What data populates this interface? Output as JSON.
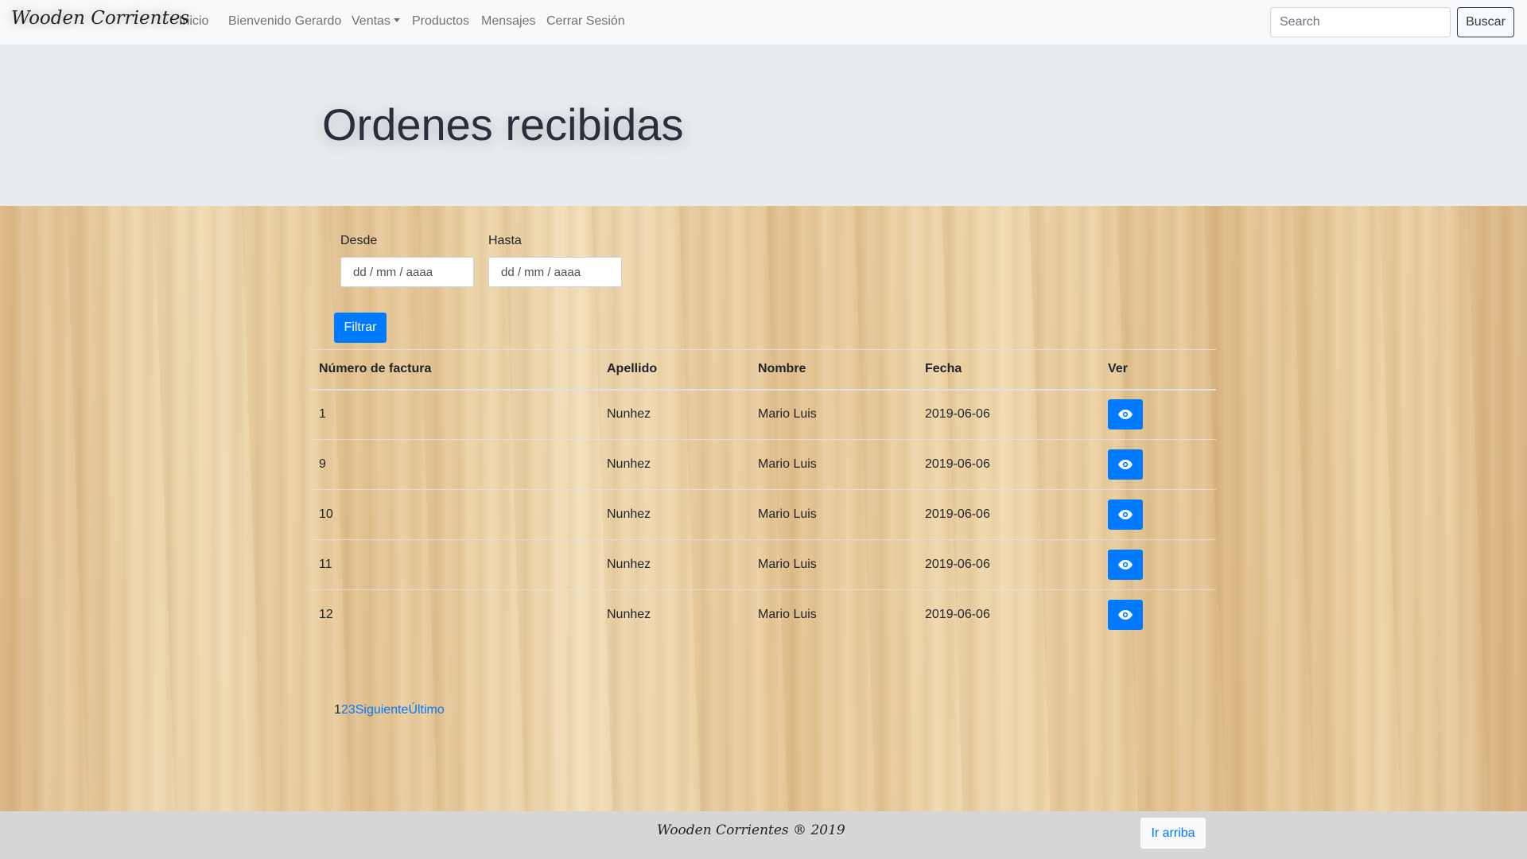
{
  "navbar": {
    "brand": "Wooden Corrientes",
    "items": [
      {
        "label": "Inicio"
      },
      {
        "label": "Bienvenido Gerardo"
      },
      {
        "label": "Ventas"
      },
      {
        "label": "Productos"
      },
      {
        "label": "Mensajes"
      },
      {
        "label": "Cerrar Sesión"
      }
    ],
    "search_placeholder": "Search",
    "search_button": "Buscar"
  },
  "jumbotron": {
    "title": "Ordenes recibidas"
  },
  "filter": {
    "from_label": "Desde",
    "from_placeholder": "dd / mm / aaaa",
    "to_label": "Hasta",
    "to_placeholder": "dd / mm / aaaa",
    "button": "Filtrar"
  },
  "table": {
    "headers": [
      "Número de factura",
      "Apellido",
      "Nombre",
      "Fecha",
      "Ver"
    ],
    "rows": [
      [
        "1",
        "Nunhez",
        "Mario Luis",
        "2019-06-06"
      ],
      [
        "9",
        "Nunhez",
        "Mario Luis",
        "2019-06-06"
      ],
      [
        "10",
        "Nunhez",
        "Mario Luis",
        "2019-06-06"
      ],
      [
        "11",
        "Nunhez",
        "Mario Luis",
        "2019-06-06"
      ],
      [
        "12",
        "Nunhez",
        "Mario Luis",
        "2019-06-06"
      ]
    ],
    "view_icon": "eye-icon"
  },
  "pagination": {
    "current": "1",
    "pages": [
      "2",
      "3"
    ],
    "next": "Siguiente",
    "last": "Último"
  },
  "footer": {
    "text": "Wooden Corrientes ® 2019",
    "top_button": "Ir arriba"
  },
  "colors": {
    "primary": "#007bff",
    "navbar_bg": "#f8f9fa",
    "jumbotron_bg": "#e9ecef",
    "footer_bg": "#d6d6d6"
  }
}
